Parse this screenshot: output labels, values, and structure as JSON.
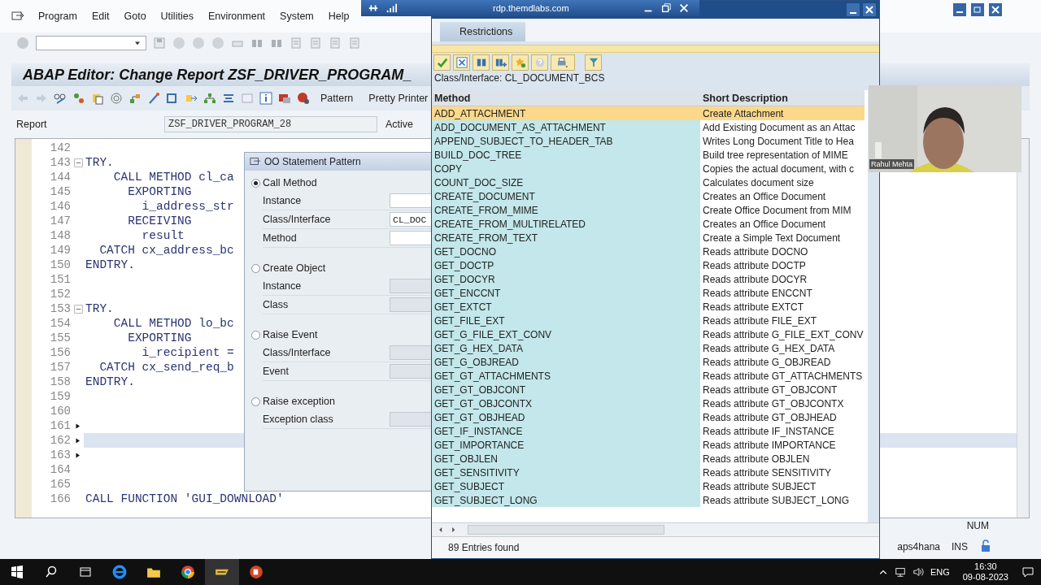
{
  "rdp_bar": {
    "host": "rdp.themdlabs.com"
  },
  "menu": [
    "Program",
    "Edit",
    "Goto",
    "Utilities",
    "Environment",
    "System",
    "Help"
  ],
  "title": "ABAP Editor: Change Report ZSF_DRIVER_PROGRAM_",
  "app_toolbar": {
    "buttons": [
      "Pattern",
      "Pretty Printer"
    ]
  },
  "report": {
    "label": "Report",
    "value": "ZSF_DRIVER_PROGRAM_28",
    "status": "Active"
  },
  "editor": {
    "lines": [
      {
        "number": "142",
        "fold": false,
        "marked": false,
        "current": false
      },
      {
        "number": "143",
        "text": "TRY.",
        "fold": true,
        "marked": false,
        "current": false
      },
      {
        "number": "144",
        "text": "    CALL METHOD cl_ca",
        "fold": false,
        "marked": false,
        "current": false
      },
      {
        "number": "145",
        "text": "      EXPORTING",
        "fold": false,
        "marked": false,
        "current": false
      },
      {
        "number": "146",
        "text": "        i_address_str",
        "fold": false,
        "marked": false,
        "current": false
      },
      {
        "number": "147",
        "text": "      RECEIVING",
        "fold": false,
        "marked": false,
        "current": false
      },
      {
        "number": "148",
        "text": "        result",
        "fold": false,
        "marked": false,
        "current": false
      },
      {
        "number": "149",
        "text": "  CATCH cx_address_bc",
        "fold": false,
        "marked": false,
        "current": false
      },
      {
        "number": "150",
        "text": "ENDTRY.",
        "fold": false,
        "marked": false,
        "current": false
      },
      {
        "number": "151",
        "fold": false,
        "marked": false,
        "current": false
      },
      {
        "number": "152",
        "fold": false,
        "marked": false,
        "current": false
      },
      {
        "number": "153",
        "text": "TRY.",
        "fold": true,
        "marked": false,
        "current": false
      },
      {
        "number": "154",
        "text": "    CALL METHOD lo_bc",
        "fold": false,
        "marked": false,
        "current": false
      },
      {
        "number": "155",
        "text": "      EXPORTING",
        "fold": false,
        "marked": false,
        "current": false
      },
      {
        "number": "156",
        "text": "        i_recipient =",
        "fold": false,
        "marked": false,
        "current": false
      },
      {
        "number": "157",
        "text": "  CATCH cx_send_req_b",
        "fold": false,
        "marked": false,
        "current": false
      },
      {
        "number": "158",
        "text": "ENDTRY.",
        "fold": false,
        "marked": false,
        "current": false
      },
      {
        "number": "159",
        "fold": false,
        "marked": false,
        "current": false
      },
      {
        "number": "160",
        "fold": false,
        "marked": false,
        "current": false
      },
      {
        "number": "161",
        "fold": false,
        "marked": true,
        "current": false
      },
      {
        "number": "162",
        "fold": false,
        "marked": true,
        "current": true
      },
      {
        "number": "163",
        "fold": false,
        "marked": true,
        "current": false
      },
      {
        "number": "164",
        "fold": false,
        "marked": false,
        "current": false
      },
      {
        "number": "165",
        "fold": false,
        "marked": false,
        "current": false
      },
      {
        "number": "166",
        "text": "CALL FUNCTION 'GUI_DOWNLOAD'",
        "fold": false,
        "marked": false,
        "current": false
      }
    ]
  },
  "status_bar": {
    "num": "NUM",
    "system": "aps4hana",
    "mode": "INS"
  },
  "pattern_dialog": {
    "title": "OO Statement Pattern",
    "groups": [
      {
        "label": "Call Method",
        "selected": true,
        "fields": [
          {
            "label": "Instance"
          },
          {
            "label": "Class/Interface",
            "value": "CL_DOC"
          },
          {
            "label": "Method"
          }
        ]
      },
      {
        "label": "Create Object",
        "selected": false,
        "fields": [
          {
            "label": "Instance"
          },
          {
            "label": "Class"
          }
        ]
      },
      {
        "label": "Raise Event",
        "selected": false,
        "fields": [
          {
            "label": "Class/Interface"
          },
          {
            "label": "Event"
          }
        ]
      },
      {
        "label": "Raise exception",
        "selected": false,
        "fields": [
          {
            "label": "Exception class"
          }
        ]
      }
    ]
  },
  "value_help": {
    "tab": "Restrictions",
    "context": "Class/Interface: CL_DOCUMENT_BCS",
    "columns": [
      "Method",
      "Short Description"
    ],
    "rows": [
      {
        "method": "ADD_ATTACHMENT",
        "description": "Create Attachment",
        "selected": true
      },
      {
        "method": "ADD_DOCUMENT_AS_ATTACHMENT",
        "description": "Add Existing Document as an Attac",
        "selected": false
      },
      {
        "method": "APPEND_SUBJECT_TO_HEADER_TAB",
        "description": "Writes Long Document Title to Hea",
        "selected": false
      },
      {
        "method": "BUILD_DOC_TREE",
        "description": "Build tree representation of MIME",
        "selected": false
      },
      {
        "method": "COPY",
        "description": "Copies the actual document, with c",
        "selected": false
      },
      {
        "method": "COUNT_DOC_SIZE",
        "description": "Calculates document size",
        "selected": false
      },
      {
        "method": "CREATE_DOCUMENT",
        "description": "Creates an Office Document",
        "selected": false
      },
      {
        "method": "CREATE_FROM_MIME",
        "description": "Create Office Document from MIM",
        "selected": false
      },
      {
        "method": "CREATE_FROM_MULTIRELATED",
        "description": "Creates an Office Document",
        "selected": false
      },
      {
        "method": "CREATE_FROM_TEXT",
        "description": "Create a Simple Text Document",
        "selected": false
      },
      {
        "method": "GET_DOCNO",
        "description": "Reads attribute DOCNO",
        "selected": false
      },
      {
        "method": "GET_DOCTP",
        "description": "Reads attribute DOCTP",
        "selected": false
      },
      {
        "method": "GET_DOCYR",
        "description": "Reads attribute DOCYR",
        "selected": false
      },
      {
        "method": "GET_ENCCNT",
        "description": "Reads attribute ENCCNT",
        "selected": false
      },
      {
        "method": "GET_EXTCT",
        "description": "Reads attribute EXTCT",
        "selected": false
      },
      {
        "method": "GET_FILE_EXT",
        "description": "Reads attribute FILE_EXT",
        "selected": false
      },
      {
        "method": "GET_G_FILE_EXT_CONV",
        "description": "Reads attribute G_FILE_EXT_CONV",
        "selected": false
      },
      {
        "method": "GET_G_HEX_DATA",
        "description": "Reads attribute G_HEX_DATA",
        "selected": false
      },
      {
        "method": "GET_G_OBJREAD",
        "description": "Reads attribute G_OBJREAD",
        "selected": false
      },
      {
        "method": "GET_GT_ATTACHMENTS",
        "description": "Reads attribute GT_ATTACHMENTS",
        "selected": false
      },
      {
        "method": "GET_GT_OBJCONT",
        "description": "Reads attribute GT_OBJCONT",
        "selected": false
      },
      {
        "method": "GET_GT_OBJCONTX",
        "description": "Reads attribute GT_OBJCONTX",
        "selected": false
      },
      {
        "method": "GET_GT_OBJHEAD",
        "description": "Reads attribute GT_OBJHEAD",
        "selected": false
      },
      {
        "method": "GET_IF_INSTANCE",
        "description": "Reads attribute IF_INSTANCE",
        "selected": false
      },
      {
        "method": "GET_IMPORTANCE",
        "description": "Reads attribute IMPORTANCE",
        "selected": false
      },
      {
        "method": "GET_OBJLEN",
        "description": "Reads attribute OBJLEN",
        "selected": false
      },
      {
        "method": "GET_SENSITIVITY",
        "description": "Reads attribute SENSITIVITY",
        "selected": false
      },
      {
        "method": "GET_SUBJECT",
        "description": "Reads attribute SUBJECT",
        "selected": false
      },
      {
        "method": "GET_SUBJECT_LONG",
        "description": "Reads attribute SUBJECT_LONG",
        "selected": false
      }
    ],
    "footer": "89 Entries found"
  },
  "webcam": {
    "kind": "picture",
    "caption": "Rahul Mehta"
  },
  "taskbar": {
    "language": "ENG",
    "time": "16:30",
    "date": "09-08-2023"
  }
}
